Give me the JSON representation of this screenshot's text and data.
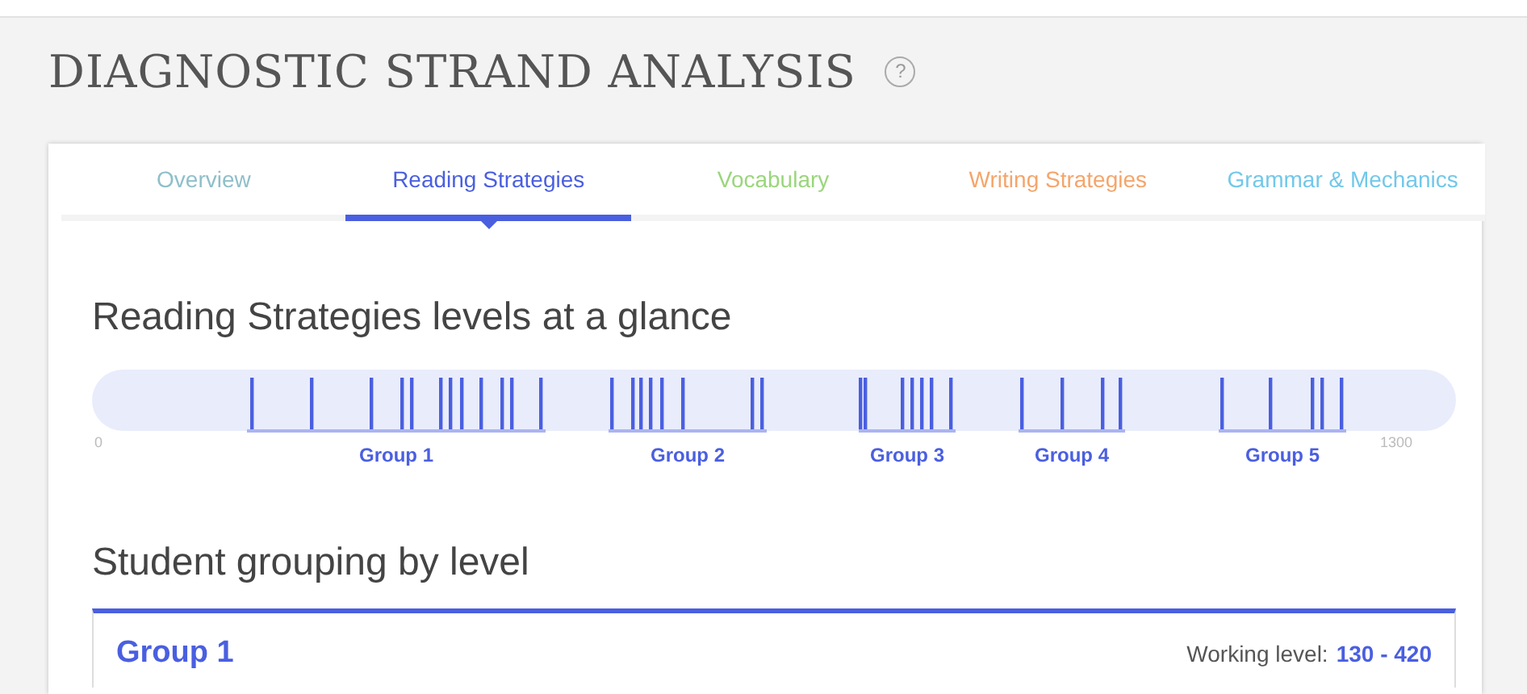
{
  "page": {
    "title": "DIAGNOSTIC STRAND ANALYSIS",
    "help_icon": "?"
  },
  "tabs": [
    {
      "label": "Overview",
      "selected": false,
      "color": "#8fbfc9"
    },
    {
      "label": "Reading Strategies",
      "selected": true,
      "color": "#4a5fe0"
    },
    {
      "label": "Vocabulary",
      "selected": false,
      "color": "#9ad67c"
    },
    {
      "label": "Writing Strategies",
      "selected": false,
      "color": "#f5a56b"
    },
    {
      "label": "Grammar & Mechanics",
      "selected": false,
      "color": "#72c8ea"
    }
  ],
  "glance": {
    "heading": "Reading Strategies levels at a glance",
    "scale_min": "0",
    "scale_max": "1300",
    "groups": [
      {
        "label": "Group 1"
      },
      {
        "label": "Group 2"
      },
      {
        "label": "Group 3"
      },
      {
        "label": "Group 4"
      },
      {
        "label": "Group 5"
      }
    ]
  },
  "grouping": {
    "heading": "Student grouping by level",
    "groups": [
      {
        "name": "Group 1",
        "level_label": "Working level:",
        "level_range": "130 - 420"
      }
    ]
  }
}
